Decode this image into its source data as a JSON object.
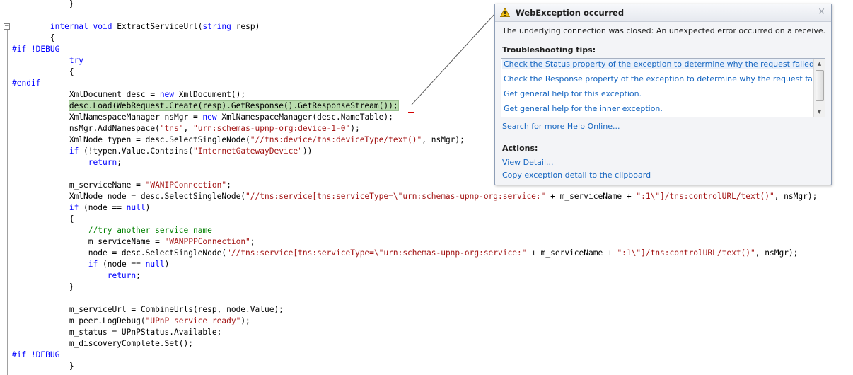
{
  "editor": {
    "collapse_symbol": "−",
    "lines": [
      [
        {
          "t": "            }",
          "c": ""
        }
      ],
      [
        {
          "t": "",
          "c": ""
        }
      ],
      [
        {
          "t": "        ",
          "c": ""
        },
        {
          "t": "internal",
          "c": "kw"
        },
        {
          "t": " ",
          "c": ""
        },
        {
          "t": "void",
          "c": "kw"
        },
        {
          "t": " ExtractServiceUrl(",
          "c": ""
        },
        {
          "t": "string",
          "c": "kw"
        },
        {
          "t": " resp)",
          "c": ""
        }
      ],
      [
        {
          "t": "        {",
          "c": ""
        }
      ],
      [
        {
          "t": "#if !DEBUG",
          "c": "kw"
        }
      ],
      [
        {
          "t": "            ",
          "c": ""
        },
        {
          "t": "try",
          "c": "kw"
        }
      ],
      [
        {
          "t": "            {",
          "c": ""
        }
      ],
      [
        {
          "t": "#endif",
          "c": "kw"
        }
      ],
      [
        {
          "t": "            XmlDocument desc = ",
          "c": ""
        },
        {
          "t": "new",
          "c": "kw"
        },
        {
          "t": " XmlDocument();",
          "c": ""
        }
      ],
      [
        {
          "t": "            ",
          "c": ""
        },
        {
          "t": "desc.Load(WebRequest.Create(resp).GetResponse().GetResponseStream());",
          "c": "hl"
        }
      ],
      [
        {
          "t": "            XmlNamespaceManager nsMgr = ",
          "c": ""
        },
        {
          "t": "new",
          "c": "kw"
        },
        {
          "t": " XmlNamespaceManager(desc.NameTable);",
          "c": ""
        }
      ],
      [
        {
          "t": "            nsMgr.AddNamespace(",
          "c": ""
        },
        {
          "t": "\"tns\"",
          "c": "st"
        },
        {
          "t": ", ",
          "c": ""
        },
        {
          "t": "\"urn:schemas-upnp-org:device-1-0\"",
          "c": "st"
        },
        {
          "t": ");",
          "c": ""
        }
      ],
      [
        {
          "t": "            XmlNode typen = desc.SelectSingleNode(",
          "c": ""
        },
        {
          "t": "\"//tns:device/tns:deviceType/text()\"",
          "c": "st"
        },
        {
          "t": ", nsMgr);",
          "c": ""
        }
      ],
      [
        {
          "t": "            ",
          "c": ""
        },
        {
          "t": "if",
          "c": "kw"
        },
        {
          "t": " (!typen.Value.Contains(",
          "c": ""
        },
        {
          "t": "\"InternetGatewayDevice\"",
          "c": "st"
        },
        {
          "t": "))",
          "c": ""
        }
      ],
      [
        {
          "t": "                ",
          "c": ""
        },
        {
          "t": "return",
          "c": "kw"
        },
        {
          "t": ";",
          "c": ""
        }
      ],
      [
        {
          "t": "",
          "c": ""
        }
      ],
      [
        {
          "t": "            m_serviceName = ",
          "c": ""
        },
        {
          "t": "\"WANIPConnection\"",
          "c": "st"
        },
        {
          "t": ";",
          "c": ""
        }
      ],
      [
        {
          "t": "            XmlNode node = desc.SelectSingleNode(",
          "c": ""
        },
        {
          "t": "\"//tns:service[tns:serviceType=\\\"urn:schemas-upnp-org:service:\"",
          "c": "st"
        },
        {
          "t": " + m_serviceName + ",
          "c": ""
        },
        {
          "t": "\":1\\\"]/tns:controlURL/text()\"",
          "c": "st"
        },
        {
          "t": ", nsMgr);",
          "c": ""
        }
      ],
      [
        {
          "t": "            ",
          "c": ""
        },
        {
          "t": "if",
          "c": "kw"
        },
        {
          "t": " (node == ",
          "c": ""
        },
        {
          "t": "null",
          "c": "kw"
        },
        {
          "t": ")",
          "c": ""
        }
      ],
      [
        {
          "t": "            {",
          "c": ""
        }
      ],
      [
        {
          "t": "                ",
          "c": ""
        },
        {
          "t": "//try another service name",
          "c": "cm"
        }
      ],
      [
        {
          "t": "                m_serviceName = ",
          "c": ""
        },
        {
          "t": "\"WANPPPConnection\"",
          "c": "st"
        },
        {
          "t": ";",
          "c": ""
        }
      ],
      [
        {
          "t": "                node = desc.SelectSingleNode(",
          "c": ""
        },
        {
          "t": "\"//tns:service[tns:serviceType=\\\"urn:schemas-upnp-org:service:\"",
          "c": "st"
        },
        {
          "t": " + m_serviceName + ",
          "c": ""
        },
        {
          "t": "\":1\\\"]/tns:controlURL/text()\"",
          "c": "st"
        },
        {
          "t": ", nsMgr);",
          "c": ""
        }
      ],
      [
        {
          "t": "                ",
          "c": ""
        },
        {
          "t": "if",
          "c": "kw"
        },
        {
          "t": " (node == ",
          "c": ""
        },
        {
          "t": "null",
          "c": "kw"
        },
        {
          "t": ")",
          "c": ""
        }
      ],
      [
        {
          "t": "                    ",
          "c": ""
        },
        {
          "t": "return",
          "c": "kw"
        },
        {
          "t": ";",
          "c": ""
        }
      ],
      [
        {
          "t": "            }",
          "c": ""
        }
      ],
      [
        {
          "t": "",
          "c": ""
        }
      ],
      [
        {
          "t": "            m_serviceUrl = CombineUrls(resp, node.Value);",
          "c": ""
        }
      ],
      [
        {
          "t": "            m_peer.LogDebug(",
          "c": ""
        },
        {
          "t": "\"UPnP service ready\"",
          "c": "st"
        },
        {
          "t": ");",
          "c": ""
        }
      ],
      [
        {
          "t": "            m_status = UPnPStatus.Available;",
          "c": ""
        }
      ],
      [
        {
          "t": "            m_discoveryComplete.Set();",
          "c": ""
        }
      ],
      [
        {
          "t": "#if !DEBUG",
          "c": "kw"
        }
      ],
      [
        {
          "t": "            }",
          "c": ""
        }
      ]
    ]
  },
  "exception": {
    "title": "WebException occurred",
    "close_symbol": "×",
    "message": "The underlying connection was closed: An unexpected error occurred on a receive.",
    "tips_title": "Troubleshooting tips:",
    "tips": [
      "Check the Status property of the exception to determine why the request failed.",
      "Check the Response property of the exception to determine why the request failed.",
      "Get general help for this exception.",
      "Get general help for the inner exception."
    ],
    "scroll_up": "▲",
    "scroll_down": "▼",
    "search_link": "Search for more Help Online...",
    "actions_title": "Actions:",
    "actions": [
      "View Detail...",
      "Copy exception detail to the clipboard"
    ]
  },
  "colors": {
    "keyword": "#0000ff",
    "string": "#a31515",
    "comment": "#008000",
    "highlight": "#b9dcae",
    "link": "#1565c0"
  }
}
